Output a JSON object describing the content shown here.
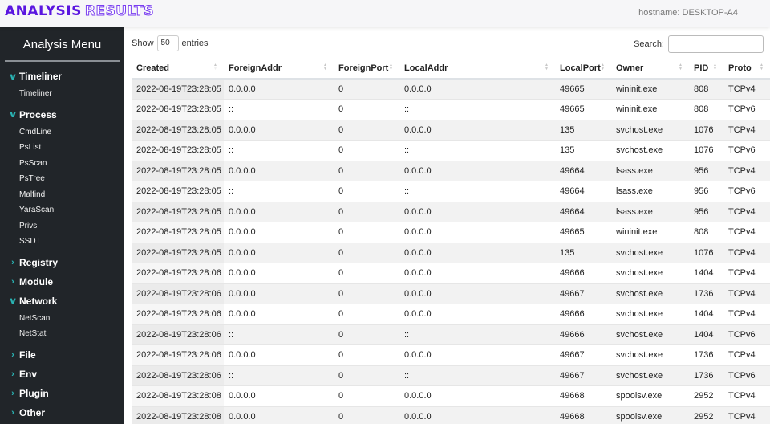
{
  "header": {
    "brand_part1": "ANALYSIS",
    "brand_part2": "RESULTS",
    "hostname": "hostname: DESKTOP-A4"
  },
  "sidebar": {
    "title": "Analysis Menu",
    "groups": [
      {
        "label": "Timeliner",
        "expanded": true,
        "items": [
          "Timeliner"
        ]
      },
      {
        "label": "Process",
        "expanded": true,
        "items": [
          "CmdLine",
          "PsList",
          "PsScan",
          "PsTree",
          "Malfind",
          "YaraScan",
          "Privs",
          "SSDT"
        ]
      },
      {
        "label": "Registry",
        "expanded": false,
        "items": []
      },
      {
        "label": "Module",
        "expanded": false,
        "items": []
      },
      {
        "label": "Network",
        "expanded": true,
        "items": [
          "NetScan",
          "NetStat"
        ]
      },
      {
        "label": "File",
        "expanded": false,
        "items": []
      },
      {
        "label": "Env",
        "expanded": false,
        "items": []
      },
      {
        "label": "Plugin",
        "expanded": false,
        "items": []
      },
      {
        "label": "Other",
        "expanded": false,
        "items": []
      }
    ]
  },
  "controls": {
    "show_label": "Show",
    "entries_value": "50",
    "entries_label": "entries",
    "search_label": "Search:",
    "search_value": ""
  },
  "table": {
    "columns": [
      "Created",
      "ForeignAddr",
      "ForeignPort",
      "LocalAddr",
      "LocalPort",
      "Owner",
      "PID",
      "Proto"
    ],
    "rows": [
      [
        "2022-08-19T23:28:05",
        "0.0.0.0",
        "0",
        "0.0.0.0",
        "49665",
        "wininit.exe",
        "808",
        "TCPv4"
      ],
      [
        "2022-08-19T23:28:05",
        "::",
        "0",
        "::",
        "49665",
        "wininit.exe",
        "808",
        "TCPv6"
      ],
      [
        "2022-08-19T23:28:05",
        "0.0.0.0",
        "0",
        "0.0.0.0",
        "135",
        "svchost.exe",
        "1076",
        "TCPv4"
      ],
      [
        "2022-08-19T23:28:05",
        "::",
        "0",
        "::",
        "135",
        "svchost.exe",
        "1076",
        "TCPv6"
      ],
      [
        "2022-08-19T23:28:05",
        "0.0.0.0",
        "0",
        "0.0.0.0",
        "49664",
        "lsass.exe",
        "956",
        "TCPv4"
      ],
      [
        "2022-08-19T23:28:05",
        "::",
        "0",
        "::",
        "49664",
        "lsass.exe",
        "956",
        "TCPv6"
      ],
      [
        "2022-08-19T23:28:05",
        "0.0.0.0",
        "0",
        "0.0.0.0",
        "49664",
        "lsass.exe",
        "956",
        "TCPv4"
      ],
      [
        "2022-08-19T23:28:05",
        "0.0.0.0",
        "0",
        "0.0.0.0",
        "49665",
        "wininit.exe",
        "808",
        "TCPv4"
      ],
      [
        "2022-08-19T23:28:05",
        "0.0.0.0",
        "0",
        "0.0.0.0",
        "135",
        "svchost.exe",
        "1076",
        "TCPv4"
      ],
      [
        "2022-08-19T23:28:06",
        "0.0.0.0",
        "0",
        "0.0.0.0",
        "49666",
        "svchost.exe",
        "1404",
        "TCPv4"
      ],
      [
        "2022-08-19T23:28:06",
        "0.0.0.0",
        "0",
        "0.0.0.0",
        "49667",
        "svchost.exe",
        "1736",
        "TCPv4"
      ],
      [
        "2022-08-19T23:28:06",
        "0.0.0.0",
        "0",
        "0.0.0.0",
        "49666",
        "svchost.exe",
        "1404",
        "TCPv4"
      ],
      [
        "2022-08-19T23:28:06",
        "::",
        "0",
        "::",
        "49666",
        "svchost.exe",
        "1404",
        "TCPv6"
      ],
      [
        "2022-08-19T23:28:06",
        "0.0.0.0",
        "0",
        "0.0.0.0",
        "49667",
        "svchost.exe",
        "1736",
        "TCPv4"
      ],
      [
        "2022-08-19T23:28:06",
        "::",
        "0",
        "::",
        "49667",
        "svchost.exe",
        "1736",
        "TCPv6"
      ],
      [
        "2022-08-19T23:28:08",
        "0.0.0.0",
        "0",
        "0.0.0.0",
        "49668",
        "spoolsv.exe",
        "2952",
        "TCPv4"
      ],
      [
        "2022-08-19T23:28:08",
        "0.0.0.0",
        "0",
        "0.0.0.0",
        "49668",
        "spoolsv.exe",
        "2952",
        "TCPv4"
      ]
    ]
  },
  "colors": {
    "brand": "#5a16e0",
    "sidebar_bg": "#212529",
    "chevron": "#2ab3b3"
  }
}
